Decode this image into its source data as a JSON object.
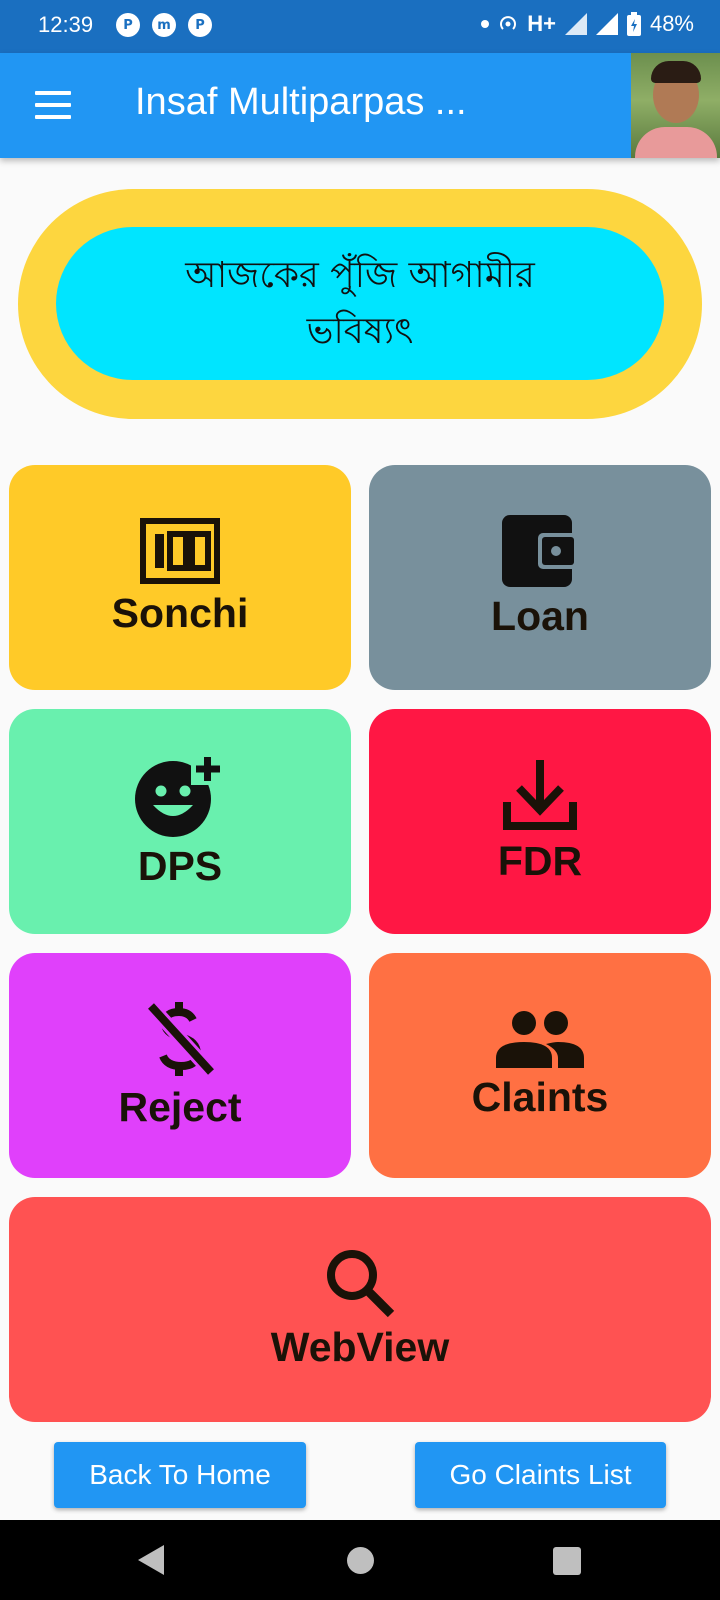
{
  "status_bar": {
    "time": "12:39",
    "app_icons": [
      "P",
      "m",
      "P"
    ],
    "network": "H+",
    "battery": "48%"
  },
  "app_bar": {
    "title": "Insaf Multiparpas ...",
    "menu_icon": "menu-icon"
  },
  "banner": {
    "text": "আজকের পুঁজি  আগামীর ভবিষ্যৎ"
  },
  "tiles": [
    {
      "label": "Sonchi",
      "icon": "money-icon",
      "color": "#ffca28"
    },
    {
      "label": "Loan",
      "icon": "wallet-icon",
      "color": "#78909c"
    },
    {
      "label": "DPS",
      "icon": "add-reaction-icon",
      "color": "#69f0ae"
    },
    {
      "label": "FDR",
      "icon": "download-icon",
      "color": "#ff1744"
    },
    {
      "label": "Reject",
      "icon": "money-off-icon",
      "color": "#e040fb"
    },
    {
      "label": "Claints",
      "icon": "people-icon",
      "color": "#ff7043"
    },
    {
      "label": "WebView",
      "icon": "search-icon",
      "color": "#ff5252"
    }
  ],
  "buttons": {
    "back_home": "Back To Home",
    "go_claints": "Go Claints List"
  }
}
